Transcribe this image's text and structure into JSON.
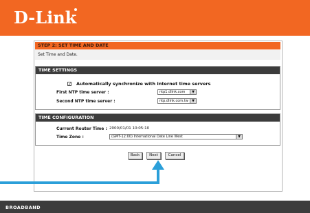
{
  "brand": {
    "logo": "D-Link"
  },
  "step": {
    "title": "STEP 2: SET TIME AND DATE",
    "subtitle": "Set Time and Date."
  },
  "time_settings": {
    "header": "TIME SETTINGS",
    "auto_sync_label": "Automatically synchronize with Internet time servers",
    "auto_sync_checked": true,
    "first_ntp_label": "First NTP time server :",
    "first_ntp_value": "ntp1.dlink.com",
    "second_ntp_label": "Second NTP time server :",
    "second_ntp_value": "ntp.dlink.com.tw"
  },
  "time_configuration": {
    "header": "TIME CONFIGURATION",
    "current_time_label": "Current Router Time :",
    "current_time_value": "2000/01/01 10:05:10",
    "time_zone_label": "Time Zone :",
    "time_zone_value": "(GMT-12:00) International Date Line West"
  },
  "buttons": {
    "back": "Back",
    "next": "Next",
    "cancel": "Cancel"
  },
  "footer": {
    "label": "BROADBAND"
  },
  "colors": {
    "brand_orange": "#f26722",
    "dark_bar": "#3c3c3c",
    "arrow_blue": "#2b9fd9"
  }
}
